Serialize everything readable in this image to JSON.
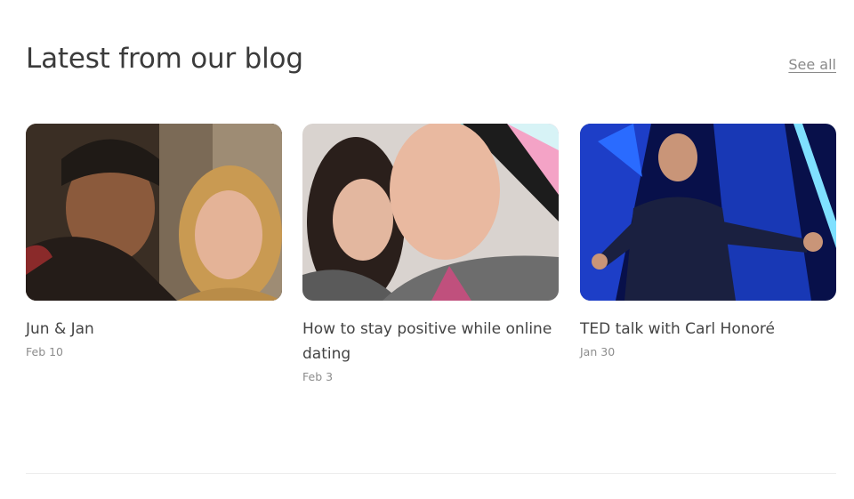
{
  "blog": {
    "heading": "Latest from our blog",
    "see_all": "See all",
    "posts": [
      {
        "title": "Jun & Jan",
        "date": "Feb 10",
        "image": "couple-selfie-photo"
      },
      {
        "title": "How to stay positive while online dating",
        "date": "Feb 3",
        "image": "smiling-couple-photo"
      },
      {
        "title": "TED talk with Carl Honoré",
        "date": "Jan 30",
        "image": "speaker-on-stage-photo"
      }
    ]
  }
}
